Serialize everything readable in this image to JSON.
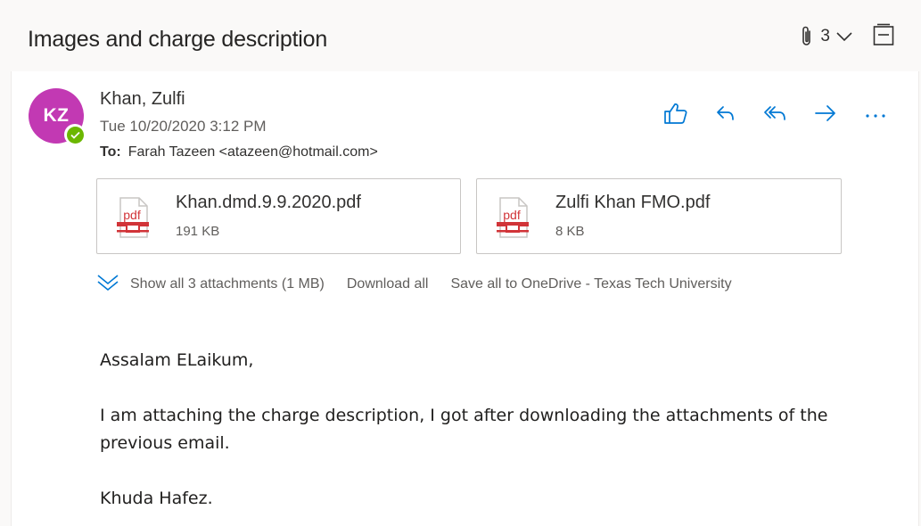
{
  "thread": {
    "title": "Images and charge description",
    "attachment_count": "3"
  },
  "message": {
    "avatar_initials": "KZ",
    "sender": "Khan, Zulfi",
    "sent_time": "Tue 10/20/2020 3:12 PM",
    "to_label": "To:",
    "recipient": "Farah Tazeen <atazeen@hotmail.com>"
  },
  "attachments": [
    {
      "name": "Khan.dmd.9.9.2020.pdf",
      "size": "191 KB",
      "icon": "pdf-file-icon",
      "icon_text": "pdf"
    },
    {
      "name": "Zulfi Khan FMO.pdf",
      "size": "8 KB",
      "icon": "pdf-file-icon",
      "icon_text": "pdf"
    }
  ],
  "attachment_bar": {
    "show_all": "Show all 3 attachments (1 MB)",
    "download_all": "Download all",
    "save_to_onedrive": "Save all to OneDrive - Texas Tech University"
  },
  "body": {
    "greeting": "Assalam ELaikum,",
    "paragraph": "I am attaching the charge description, I got after downloading the attachments of the previous email.",
    "closing": "Khuda Hafez."
  },
  "colors": {
    "accent": "#0078d4",
    "avatar_bg": "#c239b3",
    "presence_available": "#6bb700",
    "pdf_red": "#d13438"
  },
  "icons": {
    "header": [
      "paperclip-icon",
      "chevron-down-icon",
      "immersive-reader-icon"
    ],
    "actions": [
      "like-icon",
      "reply-icon",
      "reply-all-icon",
      "forward-icon",
      "more-actions-icon"
    ]
  }
}
